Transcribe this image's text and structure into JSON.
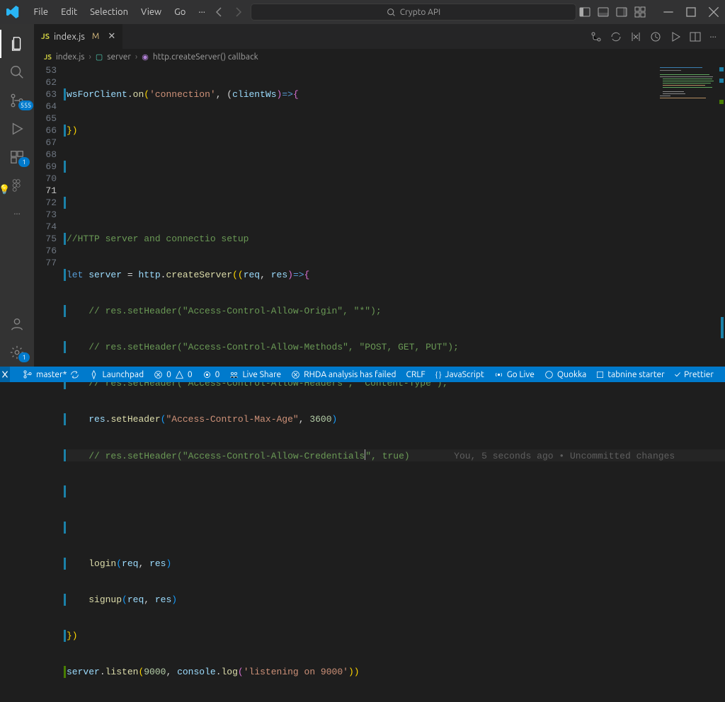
{
  "menubar": {
    "items": [
      "File",
      "Edit",
      "Selection",
      "View",
      "Go"
    ]
  },
  "search": {
    "placeholder": "Crypto API"
  },
  "activitybar": {
    "scm_badge": "555",
    "ext_badge": "1",
    "settings_badge": "1"
  },
  "tab": {
    "filename": "index.js",
    "modified": "M"
  },
  "breadcrumb": {
    "file": "index.js",
    "sym1": "server",
    "sym2": "http.createServer() callback"
  },
  "lines": [
    "53",
    "62",
    "63",
    "64",
    "65",
    "66",
    "67",
    "68",
    "69",
    "70",
    "71",
    "72",
    "73",
    "74",
    "75",
    "76",
    "77"
  ],
  "active_line": "71",
  "code": {
    "l53a": "wsForClient",
    "l53b": ".",
    "l53c": "on",
    "l53d": "(",
    "l53e": "'connection'",
    "l53f": ", (",
    "l53g": "clientWs",
    "l53h": ")",
    "l53i": "=>",
    "l53j": "{",
    "l62": "})",
    "l65": "//HTTP server and connectio setup",
    "l66a": "let",
    "l66b": " server ",
    "l66c": "=",
    "l66d": " http",
    "l66e": ".",
    "l66f": "createServer",
    "l66g": "((",
    "l66h": "req",
    "l66i": ", ",
    "l66j": "res",
    "l66k": ")",
    "l66l": "=>",
    "l66m": "{",
    "l67": "// res.setHeader(\"Access-Control-Allow-Origin\", \"*\");",
    "l68": "// res.setHeader(\"Access-Control-Allow-Methods\", \"POST, GET, PUT\");",
    "l69": "// res.setHeader(\"Access-Control-Allow-Headers\", \"Content-Type\");",
    "l70a": "res",
    "l70b": ".",
    "l70c": "setHeader",
    "l70d": "(",
    "l70e": "\"Access-Control-Max-Age\"",
    "l70f": ", ",
    "l70g": "3600",
    "l70h": ")",
    "l71a": "// res.setHeader(\"Access-Control-Allow-Credentials",
    "l71b": "\", true)",
    "l74a": "login",
    "l74b": "(",
    "l74c": "req",
    "l74d": ", ",
    "l74e": "res",
    "l74f": ")",
    "l75a": "signup",
    "l75b": "(",
    "l75c": "req",
    "l75d": ", ",
    "l75e": "res",
    "l75f": ")",
    "l76": "})",
    "l77a": "server",
    "l77b": ".",
    "l77c": "listen",
    "l77d": "(",
    "l77e": "9000",
    "l77f": ", ",
    "l77g": "console",
    "l77h": ".",
    "l77i": "log",
    "l77j": "(",
    "l77k": "'listening on 9000'",
    "l77l": "))"
  },
  "codelens": "You, 5 seconds ago • Uncommitted changes",
  "status": {
    "branch": "master*",
    "sync": "",
    "launchpad": "Launchpad",
    "errors": "0",
    "warnings": "0",
    "port": "0",
    "liveshare": "Live Share",
    "rhda": "RHDA analysis has failed",
    "crlf": "CRLF",
    "lang": "JavaScript",
    "golive": "Go Live",
    "quokka": "Quokka",
    "tabnine": "tabnine starter",
    "prettier": "Prettier"
  }
}
